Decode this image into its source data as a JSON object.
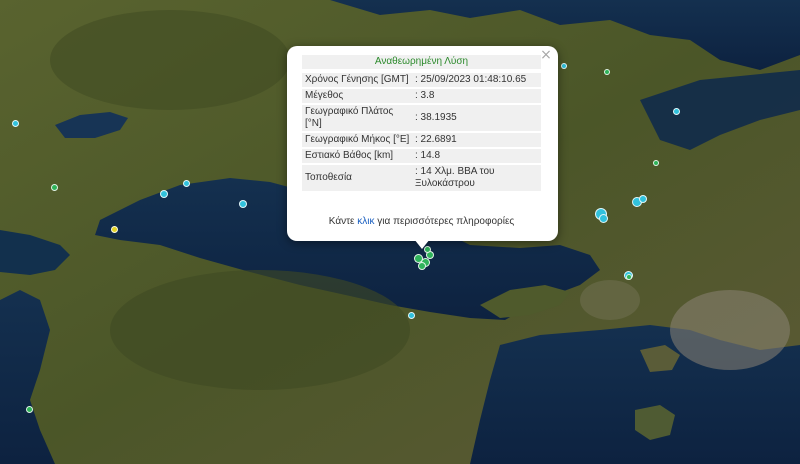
{
  "popup": {
    "title": "Αναθεωρημένη Λύση",
    "close": "×",
    "rows": [
      {
        "label": "Χρόνος Γένησης [GMT]",
        "value": ": 25/09/2023 01:48:10.65"
      },
      {
        "label": "Μέγεθος",
        "value": ": 3.8"
      },
      {
        "label": "Γεωγραφικό Πλάτος [°N]",
        "value": ": 38.1935"
      },
      {
        "label": "Γεωγραφικό Μήκος [°E]",
        "value": ": 22.6891"
      },
      {
        "label": "Εστιακό Βάθος [km]",
        "value": ": 14.8"
      },
      {
        "label": "Τοποθεσία",
        "value": ": 14 Χλμ. ΒΒΑ του Ξυλοκάστρου"
      }
    ],
    "footer_pre": "Κάντε ",
    "footer_link": "κλικ",
    "footer_post": " για περισσότερες πληροφορίες"
  },
  "colors": {
    "land": "#4d5a2c",
    "sea": "#102544",
    "marker_green": "#2fb35a",
    "marker_cyan": "#31c2dd",
    "marker_yellow": "#e4d326",
    "popup_title": "#2c8a2c",
    "link": "#1a5fc0"
  }
}
